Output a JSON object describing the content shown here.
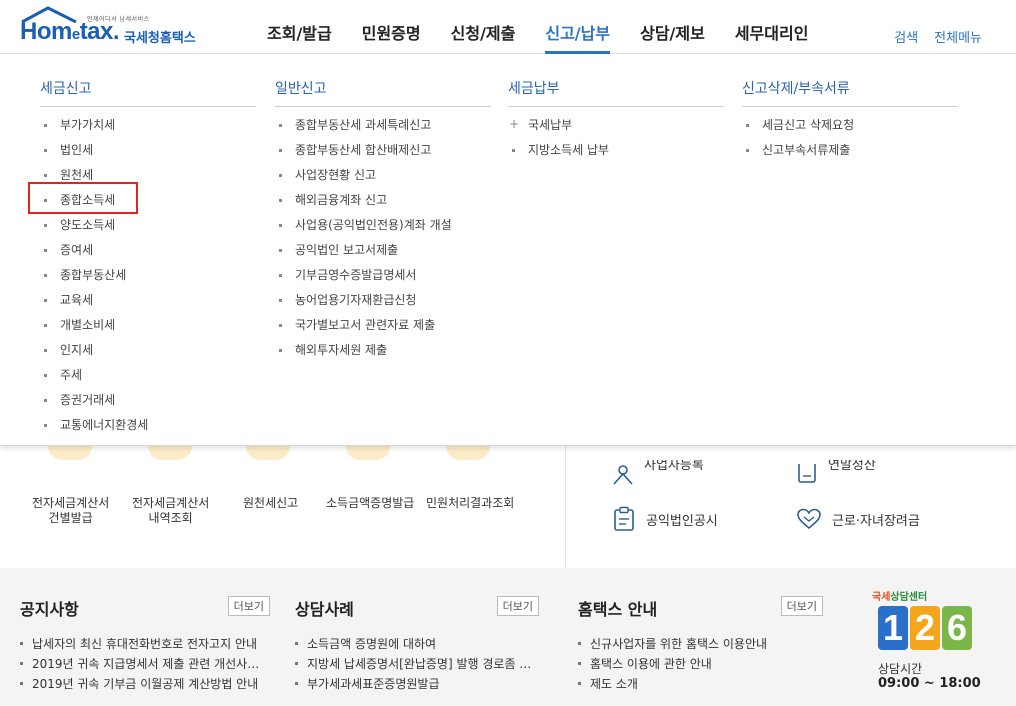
{
  "header": {
    "logo_small": "언제어디서 납세서비스",
    "logo_brand_1": "Hom",
    "logo_brand_e": "e",
    "logo_brand_2": "tax.",
    "logo_kr": "국세청홈택스",
    "nav": [
      "조회/발급",
      "민원증명",
      "신청/제출",
      "신고/납부",
      "상담/제보",
      "세무대리인"
    ],
    "active_nav": "신고/납부",
    "util": {
      "search": "검색",
      "allmenu": "전체메뉴"
    },
    "accent": "#2a73c6"
  },
  "mega_menu": {
    "columns": [
      {
        "title": "세금신고",
        "items": [
          "부가가치세",
          "법인세",
          "원천세",
          "종합소득세",
          "양도소득세",
          "증여세",
          "종합부동산세",
          "교육세",
          "개별소비세",
          "인지세",
          "주세",
          "증권거래세",
          "교통에너지환경세"
        ]
      },
      {
        "title": "일반신고",
        "items": [
          "종합부동산세 과세특례신고",
          "종합부동산세 합산배제신고",
          "사업장현황 신고",
          "해외금융계좌 신고",
          "사업용(공익법인전용)계좌 개설",
          "공익법인 보고서제출",
          "기부금영수증발급명세서",
          "농어업용기자재환급신청",
          "국가별보고서 관련자료 제출",
          "해외투자세원 제출"
        ]
      },
      {
        "title": "세금납부",
        "items": [
          "국세납부",
          "지방소득세 납부"
        ]
      },
      {
        "title": "신고삭제/부속서류",
        "items": [
          "세금신고 삭제요청",
          "신고부속서류제출"
        ]
      }
    ],
    "highlight_item": "종합소득세",
    "highlight_color": "#e0241e"
  },
  "quick_links": [
    {
      "line1": "전자세금계산서",
      "line2": "건별발급"
    },
    {
      "line1": "전자세금계산서",
      "line2": "내역조회"
    },
    {
      "line1": "원천세신고",
      "line2": ""
    },
    {
      "line1": "소득금액증명발급",
      "line2": ""
    },
    {
      "line1": "민원처리결과조회",
      "line2": ""
    }
  ],
  "right_links": {
    "row1_left": "사업자등록",
    "row1_right": "연말정산",
    "row2_left": "공익법인공시",
    "row2_right": "근로·자녀장려금"
  },
  "notice": {
    "title": "공지사항",
    "more": "더보기",
    "items": [
      "납세자의 최신 휴대전화번호로 전자고지 안내",
      "2019년 귀속 지급명세서 제출 관련 개선사…",
      "2019년 귀속 기부금 이월공제 계산방법 안내"
    ]
  },
  "counsel": {
    "title": "상담사례",
    "more": "더보기",
    "items": [
      "소득금액 증명원에 대하여",
      "지방세 납세증명서[완납증명] 발행 경로좀 …",
      "부가세과세표준증명원발급"
    ]
  },
  "guide": {
    "title": "홈택스 안내",
    "more": "더보기",
    "items": [
      "신규사업자를 위한 홈택스 이용안내",
      "홈택스 이용에 관한 안내",
      "제도 소개"
    ]
  },
  "call_center": {
    "title_1": "국세",
    "title_2": "상담센터",
    "digits": [
      "1",
      "2",
      "6"
    ],
    "digit_colors": [
      "#2a6fc9",
      "#f3a51b",
      "#7ab648"
    ],
    "hours_label": "상담시간",
    "hours": "09:00 ~ 18:00"
  }
}
